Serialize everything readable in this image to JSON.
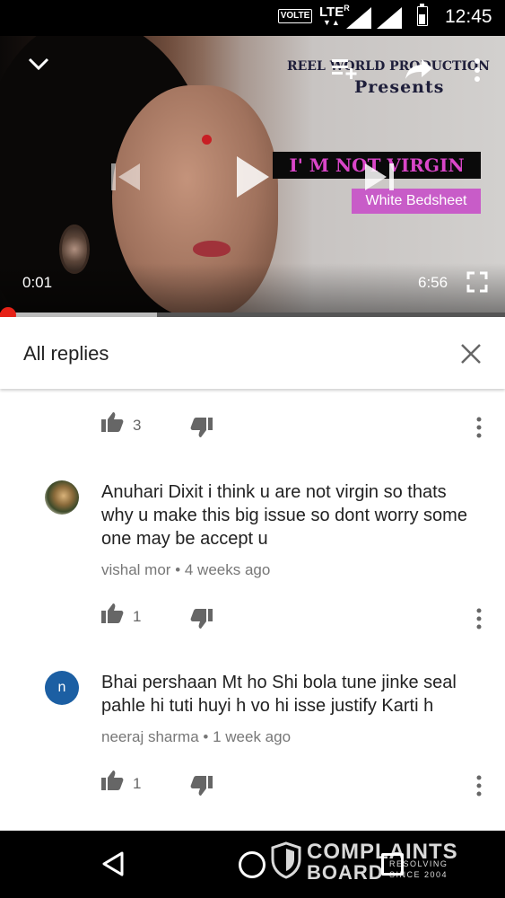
{
  "status_bar": {
    "volte": "VOLTE",
    "network": "LTE",
    "network_sup": "R",
    "time": "12:45"
  },
  "video": {
    "studio_text": "REEL WORLD PRODUCTION",
    "presents_text": "Presents",
    "film_title": "I' M NOT VIRGIN",
    "film_subtitle": "White Bedsheet",
    "current_time": "0:01",
    "duration": "6:56",
    "played_fraction": 0.003,
    "buffered_fraction": 0.31
  },
  "replies_panel": {
    "title": "All replies"
  },
  "top_likes": {
    "count": "3"
  },
  "comments": [
    {
      "text": "Anuhari Dixit i think u are not virgin so thats why u make this big issue so dont worry some one may be accept u",
      "author": "vishal mor",
      "age": "4 weeks ago",
      "likes": "1",
      "avatar_letter": ""
    },
    {
      "text": "Bhai pershaan Mt ho Shi bola tune jinke seal pahle hi tuti huyi h vo hi isse justify Karti h",
      "author": "neeraj sharma",
      "age": "1 week ago",
      "likes": "1",
      "avatar_letter": "n"
    }
  ],
  "watermark": {
    "line1": "COMPLAINTS",
    "line2": "BOARD",
    "tag1": "RESOLVING",
    "tag2": "SINCE 2004"
  },
  "colors": {
    "accent": "#e62117",
    "avatar_blue": "#1c5fa3"
  }
}
